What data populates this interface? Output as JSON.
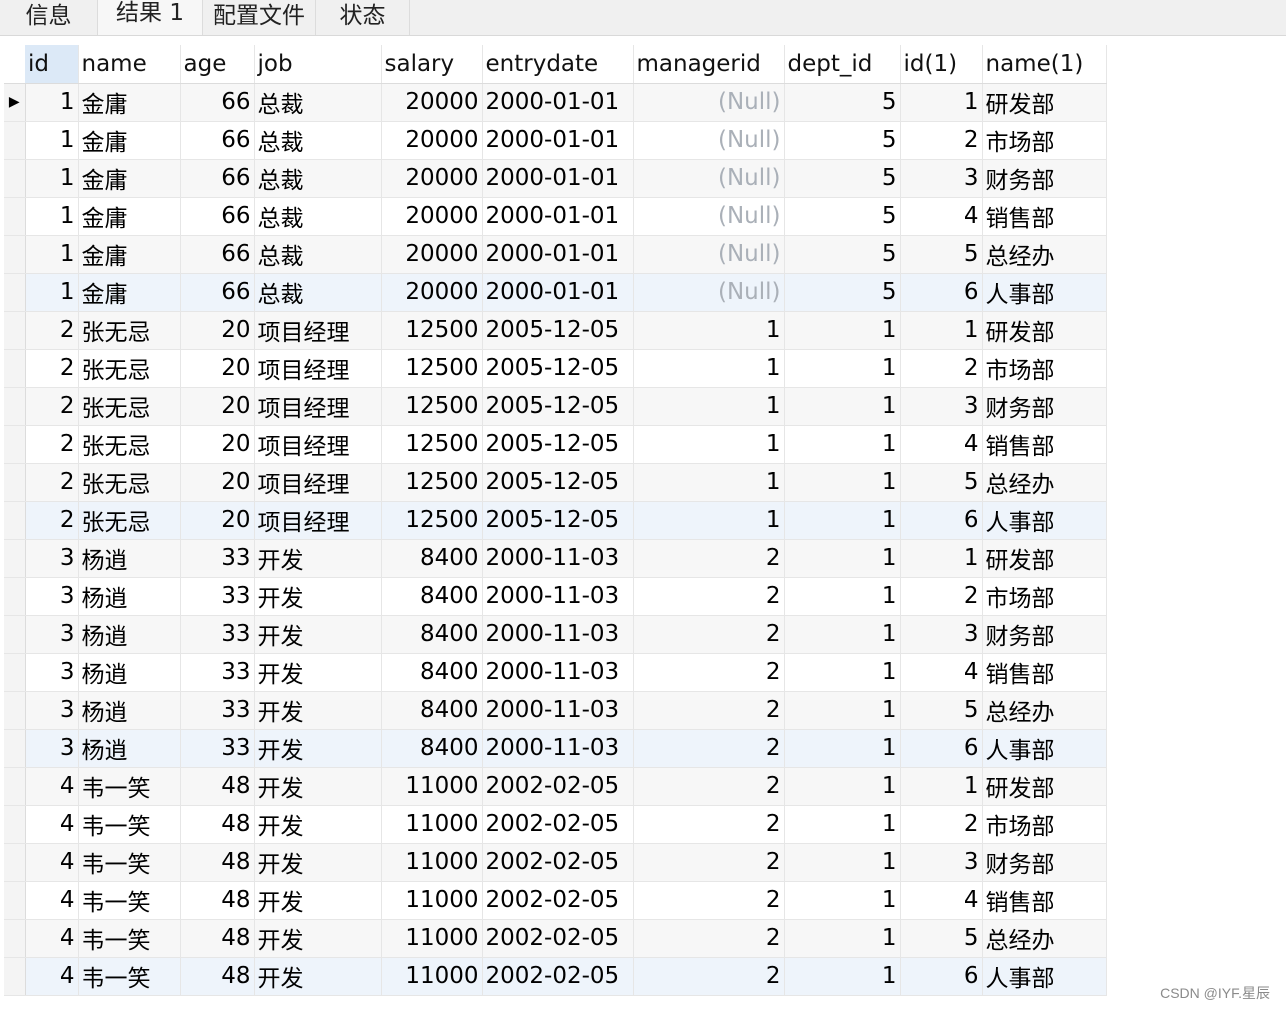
{
  "tabs": [
    {
      "label": "信息"
    },
    {
      "label": "结果 1"
    },
    {
      "label": "配置文件"
    },
    {
      "label": "状态"
    }
  ],
  "columns": [
    "id",
    "name",
    "age",
    "job",
    "salary",
    "entrydate",
    "managerid",
    "dept_id",
    "id(1)",
    "name(1)"
  ],
  "rows": [
    [
      "1",
      "金庸",
      "66",
      "总裁",
      "20000",
      "2000-01-01",
      "(Null)",
      "5",
      "1",
      "研发部"
    ],
    [
      "1",
      "金庸",
      "66",
      "总裁",
      "20000",
      "2000-01-01",
      "(Null)",
      "5",
      "2",
      "市场部"
    ],
    [
      "1",
      "金庸",
      "66",
      "总裁",
      "20000",
      "2000-01-01",
      "(Null)",
      "5",
      "3",
      "财务部"
    ],
    [
      "1",
      "金庸",
      "66",
      "总裁",
      "20000",
      "2000-01-01",
      "(Null)",
      "5",
      "4",
      "销售部"
    ],
    [
      "1",
      "金庸",
      "66",
      "总裁",
      "20000",
      "2000-01-01",
      "(Null)",
      "5",
      "5",
      "总经办"
    ],
    [
      "1",
      "金庸",
      "66",
      "总裁",
      "20000",
      "2000-01-01",
      "(Null)",
      "5",
      "6",
      "人事部"
    ],
    [
      "2",
      "张无忌",
      "20",
      "项目经理",
      "12500",
      "2005-12-05",
      "1",
      "1",
      "1",
      "研发部"
    ],
    [
      "2",
      "张无忌",
      "20",
      "项目经理",
      "12500",
      "2005-12-05",
      "1",
      "1",
      "2",
      "市场部"
    ],
    [
      "2",
      "张无忌",
      "20",
      "项目经理",
      "12500",
      "2005-12-05",
      "1",
      "1",
      "3",
      "财务部"
    ],
    [
      "2",
      "张无忌",
      "20",
      "项目经理",
      "12500",
      "2005-12-05",
      "1",
      "1",
      "4",
      "销售部"
    ],
    [
      "2",
      "张无忌",
      "20",
      "项目经理",
      "12500",
      "2005-12-05",
      "1",
      "1",
      "5",
      "总经办"
    ],
    [
      "2",
      "张无忌",
      "20",
      "项目经理",
      "12500",
      "2005-12-05",
      "1",
      "1",
      "6",
      "人事部"
    ],
    [
      "3",
      "杨逍",
      "33",
      "开发",
      "8400",
      "2000-11-03",
      "2",
      "1",
      "1",
      "研发部"
    ],
    [
      "3",
      "杨逍",
      "33",
      "开发",
      "8400",
      "2000-11-03",
      "2",
      "1",
      "2",
      "市场部"
    ],
    [
      "3",
      "杨逍",
      "33",
      "开发",
      "8400",
      "2000-11-03",
      "2",
      "1",
      "3",
      "财务部"
    ],
    [
      "3",
      "杨逍",
      "33",
      "开发",
      "8400",
      "2000-11-03",
      "2",
      "1",
      "4",
      "销售部"
    ],
    [
      "3",
      "杨逍",
      "33",
      "开发",
      "8400",
      "2000-11-03",
      "2",
      "1",
      "5",
      "总经办"
    ],
    [
      "3",
      "杨逍",
      "33",
      "开发",
      "8400",
      "2000-11-03",
      "2",
      "1",
      "6",
      "人事部"
    ],
    [
      "4",
      "韦一笑",
      "48",
      "开发",
      "11000",
      "2002-02-05",
      "2",
      "1",
      "1",
      "研发部"
    ],
    [
      "4",
      "韦一笑",
      "48",
      "开发",
      "11000",
      "2002-02-05",
      "2",
      "1",
      "2",
      "市场部"
    ],
    [
      "4",
      "韦一笑",
      "48",
      "开发",
      "11000",
      "2002-02-05",
      "2",
      "1",
      "3",
      "财务部"
    ],
    [
      "4",
      "韦一笑",
      "48",
      "开发",
      "11000",
      "2002-02-05",
      "2",
      "1",
      "4",
      "销售部"
    ],
    [
      "4",
      "韦一笑",
      "48",
      "开发",
      "11000",
      "2002-02-05",
      "2",
      "1",
      "5",
      "总经办"
    ],
    [
      "4",
      "韦一笑",
      "48",
      "开发",
      "11000",
      "2002-02-05",
      "2",
      "1",
      "6",
      "人事部"
    ]
  ],
  "watermark": "CSDN @IYF.星辰",
  "colors": {
    "null_text": "#aab0b8",
    "selected_header": "#dce9f7"
  }
}
